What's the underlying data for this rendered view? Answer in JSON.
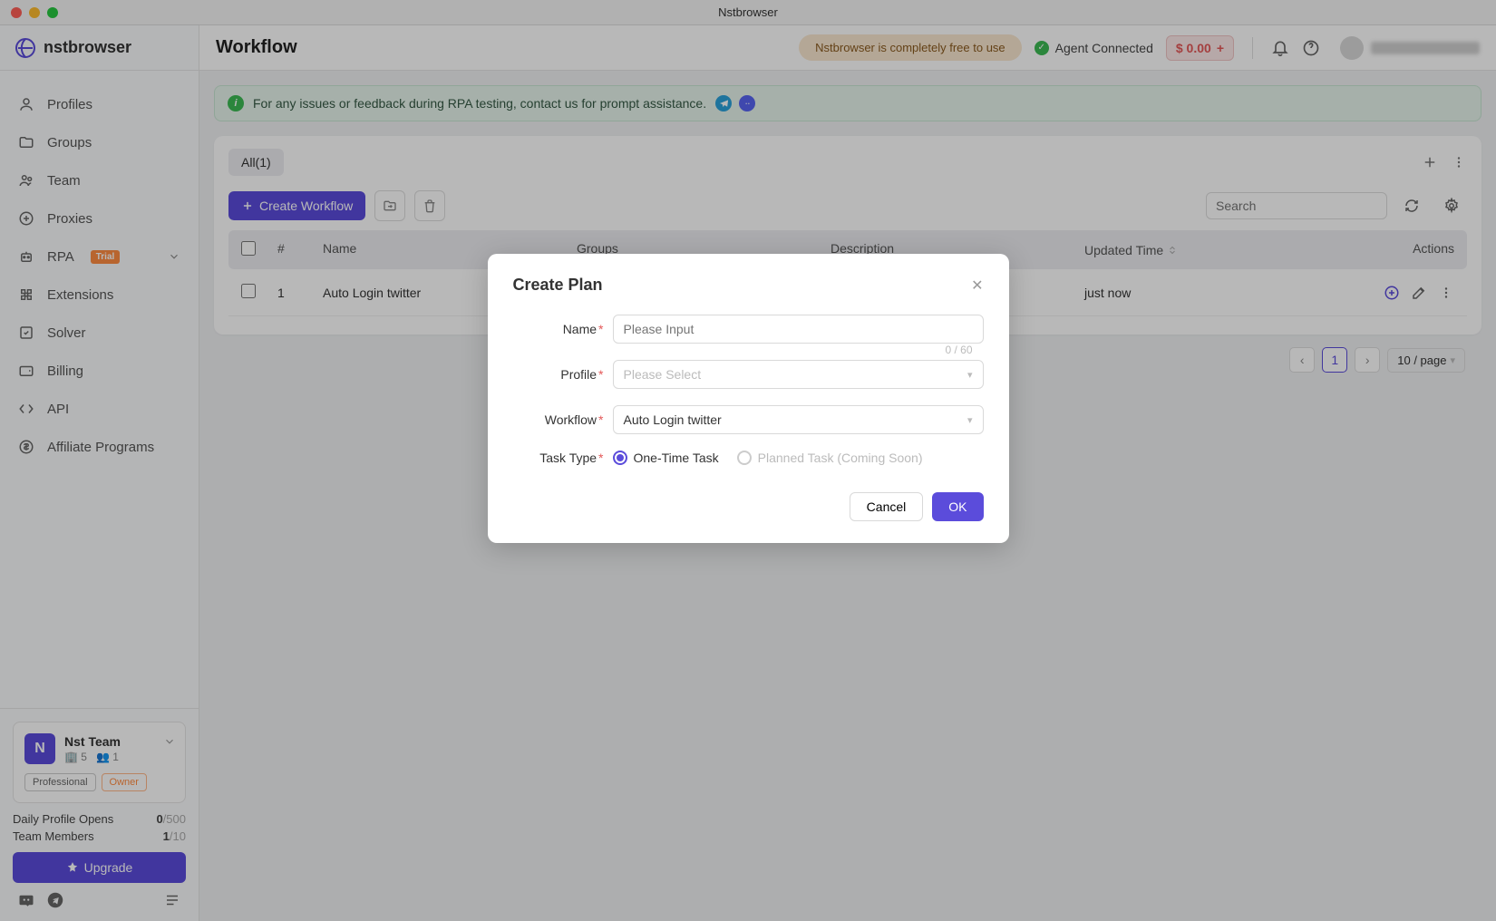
{
  "titlebar": {
    "title": "Nstbrowser"
  },
  "logo": "nstbrowser",
  "sidebar": {
    "items": [
      {
        "label": "Profiles"
      },
      {
        "label": "Groups"
      },
      {
        "label": "Team"
      },
      {
        "label": "Proxies"
      },
      {
        "label": "RPA",
        "trial": "Trial"
      },
      {
        "label": "Extensions"
      },
      {
        "label": "Solver"
      },
      {
        "label": "Billing"
      },
      {
        "label": "API"
      },
      {
        "label": "Affiliate Programs"
      }
    ]
  },
  "team_card": {
    "avatar": "N",
    "name": "Nst Team",
    "buildings": "5",
    "members_icon": "1",
    "badge_pro": "Professional",
    "badge_owner": "Owner",
    "daily_label": "Daily Profile Opens",
    "daily_used": "0",
    "daily_sep": "/",
    "daily_total": "500",
    "members_label": "Team Members",
    "members_used": "1",
    "members_sep": "/",
    "members_total": "10",
    "upgrade": "Upgrade"
  },
  "topbar": {
    "page_title": "Workflow",
    "free_pill": "Nstbrowser is completely free to use",
    "agent": "Agent Connected",
    "balance": "$ 0.00"
  },
  "banner": {
    "text": "For any issues or feedback during RPA testing, contact us for prompt assistance."
  },
  "tabs": {
    "all": "All(1)"
  },
  "toolbar": {
    "create": "Create Workflow",
    "search_placeholder": "Search"
  },
  "table": {
    "cols": {
      "num": "#",
      "name": "Name",
      "groups": "Groups",
      "desc": "Description",
      "updated": "Updated Time",
      "actions": "Actions"
    },
    "rows": [
      {
        "num": "1",
        "name": "Auto Login twitter",
        "groups": "-",
        "desc": "-",
        "updated": "just now"
      }
    ]
  },
  "pagination": {
    "current": "1",
    "page_size": "10 / page"
  },
  "modal": {
    "title": "Create Plan",
    "name_label": "Name",
    "name_placeholder": "Please Input",
    "name_counter": "0 / 60",
    "profile_label": "Profile",
    "profile_placeholder": "Please Select",
    "workflow_label": "Workflow",
    "workflow_value": "Auto Login twitter",
    "task_label": "Task Type",
    "task_opt1": "One-Time Task",
    "task_opt2": "Planned Task (Coming Soon)",
    "cancel": "Cancel",
    "ok": "OK"
  }
}
